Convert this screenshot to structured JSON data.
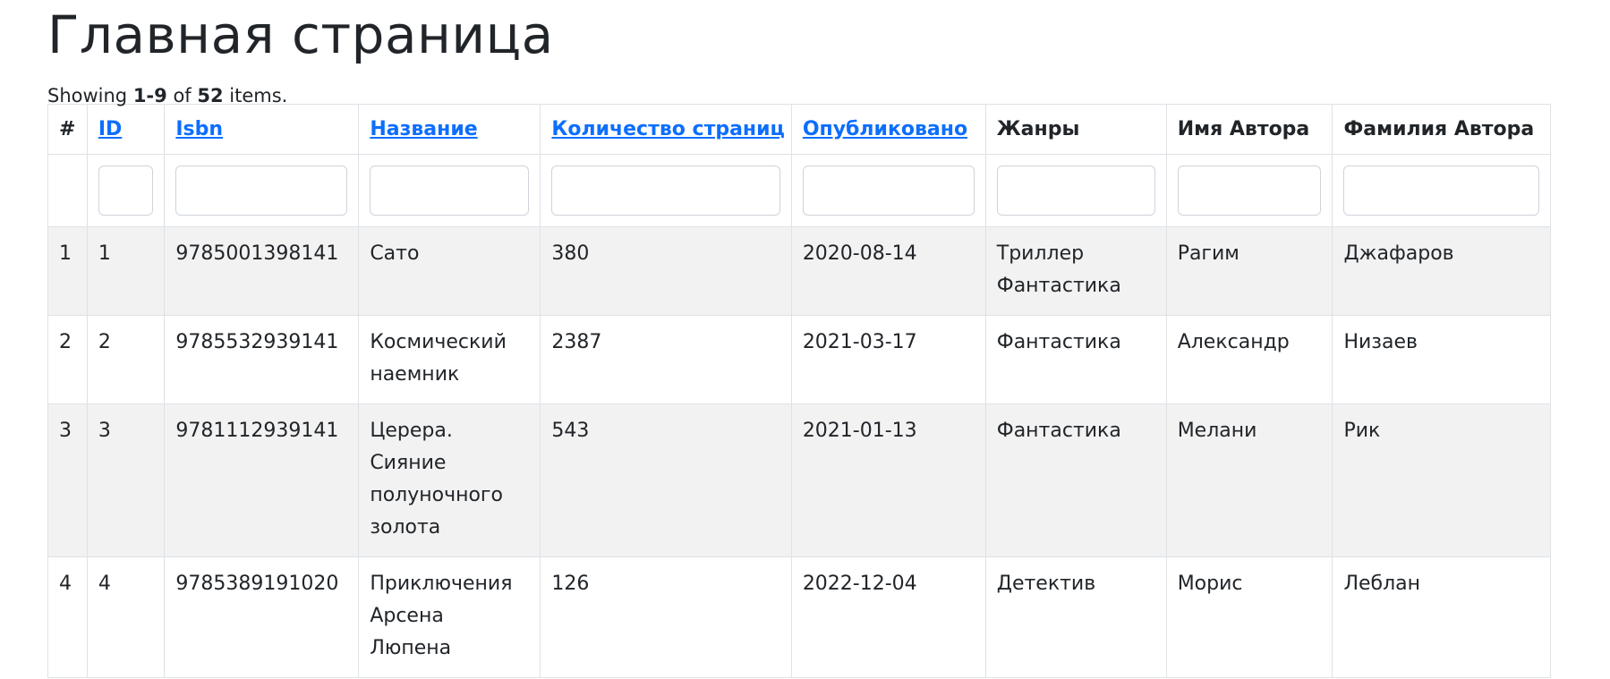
{
  "page": {
    "title": "Главная страница",
    "summary": {
      "prefix": "Showing ",
      "range": "1-9",
      "middle": " of ",
      "total": "52",
      "suffix": " items."
    }
  },
  "table": {
    "columns": {
      "num": "#",
      "id": "ID",
      "isbn": "Isbn",
      "name": "Название",
      "pages": "Количество страниц",
      "published": "Опубликовано",
      "genres": "Жанры",
      "author_first": "Имя Автора",
      "author_last": "Фамилия Автора"
    },
    "filters": {
      "id": "",
      "isbn": "",
      "name": "",
      "pages": "",
      "published": "",
      "genres": "",
      "author_first": "",
      "author_last": ""
    },
    "rows": [
      {
        "num": "1",
        "id": "1",
        "isbn": "9785001398141",
        "name": "Сато",
        "pages": "380",
        "published": "2020-08-14",
        "genres": [
          "Триллер",
          "Фантастика"
        ],
        "author_first": "Рагим",
        "author_last": "Джафаров"
      },
      {
        "num": "2",
        "id": "2",
        "isbn": "9785532939141",
        "name": "Космический наемник",
        "pages": "2387",
        "published": "2021-03-17",
        "genres": [
          "Фантастика"
        ],
        "author_first": "Александр",
        "author_last": "Низаев"
      },
      {
        "num": "3",
        "id": "3",
        "isbn": "9781112939141",
        "name": "Церера. Сияние полуночного золота",
        "pages": "543",
        "published": "2021-01-13",
        "genres": [
          "Фантастика"
        ],
        "author_first": "Мелани",
        "author_last": "Рик"
      },
      {
        "num": "4",
        "id": "4",
        "isbn": "9785389191020",
        "name": "Приключения Арсена Люпена",
        "pages": "126",
        "published": "2022-12-04",
        "genres": [
          "Детектив"
        ],
        "author_first": "Морис",
        "author_last": "Леблан"
      }
    ]
  },
  "colors": {
    "link": "#0d6efd",
    "stripe": "#f2f2f2",
    "border": "#dee2e6",
    "text": "#212529"
  }
}
